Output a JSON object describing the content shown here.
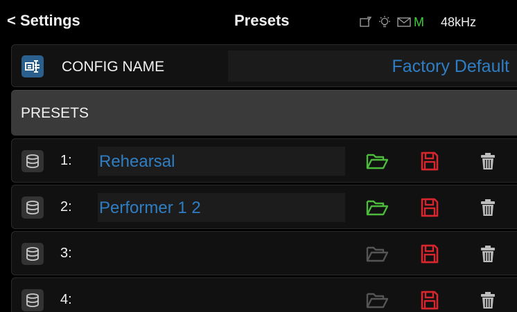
{
  "header": {
    "back_label": "< Settings",
    "title": "Presets",
    "status_icons": [
      "tablet-edit-icon",
      "lightbulb-icon",
      "envelope-icon"
    ],
    "status_m": "M",
    "sample_rate": "48kHz"
  },
  "config": {
    "label": "CONFIG NAME",
    "value": "Factory Default",
    "icon": "config-name-icon"
  },
  "presets_header": "PRESETS",
  "presets": [
    {
      "number": "1:",
      "name": "Rehearsal",
      "load_enabled": true
    },
    {
      "number": "2:",
      "name": "Performer 1  2",
      "load_enabled": true
    },
    {
      "number": "3:",
      "name": "",
      "load_enabled": false
    },
    {
      "number": "4:",
      "name": "",
      "load_enabled": false
    }
  ],
  "colors": {
    "accent_blue": "#2f7ec4",
    "load_active": "#4cbb3c",
    "load_inactive": "#555555",
    "save": "#d8262e",
    "delete": "#bdbdbd",
    "status_green": "#3ad03a"
  }
}
